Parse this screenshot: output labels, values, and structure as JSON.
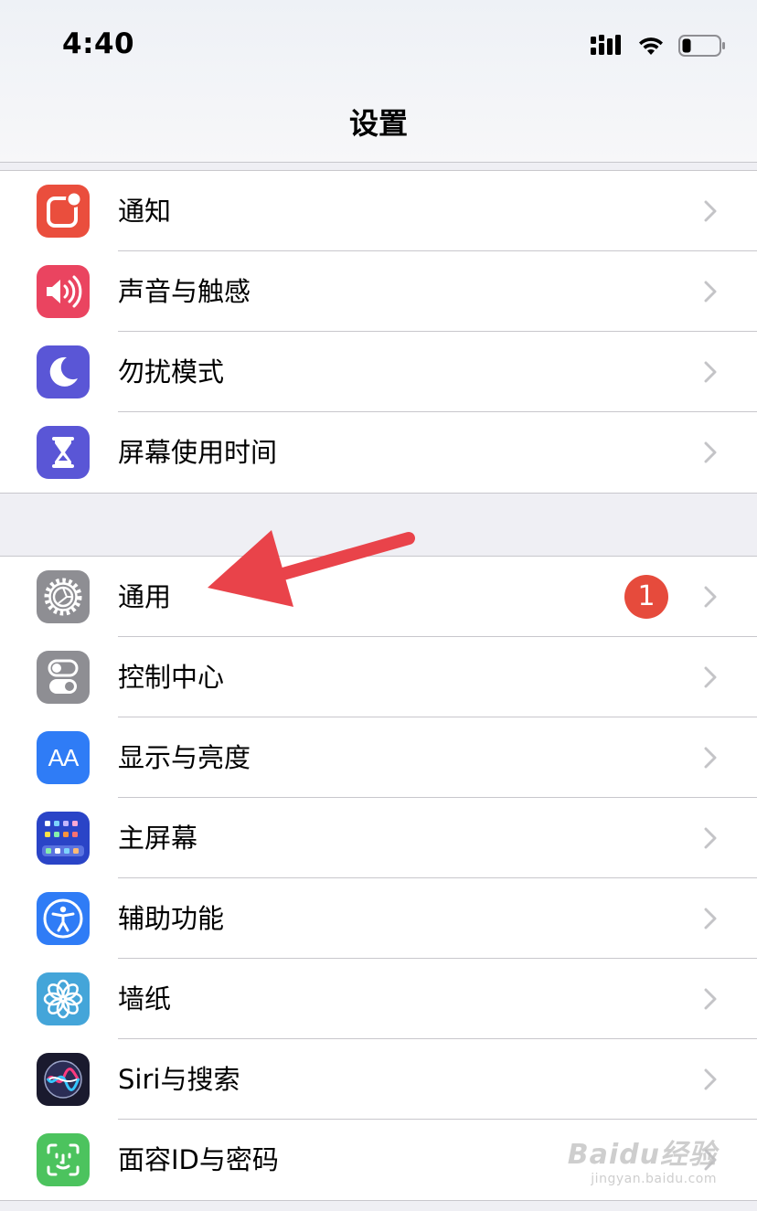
{
  "status_bar": {
    "time": "4:40"
  },
  "nav": {
    "title": "设置"
  },
  "group1": [
    {
      "label": "通知",
      "icon": "notifications-icon",
      "color": "#ea4e3d"
    },
    {
      "label": "声音与触感",
      "icon": "speaker-icon",
      "color": "#ea4460"
    },
    {
      "label": "勿扰模式",
      "icon": "moon-icon",
      "color": "#5a56d6"
    },
    {
      "label": "屏幕使用时间",
      "icon": "hourglass-icon",
      "color": "#5a56d6"
    }
  ],
  "group2": [
    {
      "label": "通用",
      "icon": "gear-icon",
      "color": "#8e8e93",
      "badge": "1"
    },
    {
      "label": "控制中心",
      "icon": "toggles-icon",
      "color": "#8e8e93"
    },
    {
      "label": "显示与亮度",
      "icon": "text-size-icon",
      "color": "#2f7cf6",
      "icon_text": "AA"
    },
    {
      "label": "主屏幕",
      "icon": "home-screen-icon",
      "color": "#2a44c7"
    },
    {
      "label": "辅助功能",
      "icon": "accessibility-icon",
      "color": "#2f7cf6"
    },
    {
      "label": "墙纸",
      "icon": "flower-icon",
      "color": "#44a5d9"
    },
    {
      "label": "Siri与搜索",
      "icon": "siri-icon",
      "color": "#1a1a2e"
    },
    {
      "label": "面容ID与密码",
      "icon": "face-id-icon",
      "color": "#4cc35e"
    }
  ],
  "watermark": {
    "brand": "Baidu经验",
    "sub": "jingyan.baidu.com"
  }
}
